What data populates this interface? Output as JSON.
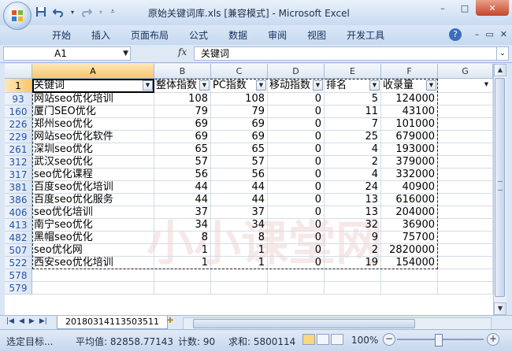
{
  "window": {
    "title": "原始关键词库.xls  [兼容模式] - Microsoft Excel",
    "controls": [
      "–",
      "□",
      "✕"
    ]
  },
  "ribbon": {
    "tabs": [
      "开始",
      "插入",
      "页面布局",
      "公式",
      "数据",
      "审阅",
      "视图",
      "开发工具"
    ],
    "help": "?"
  },
  "formula_bar": {
    "cell_ref": "A1",
    "fx": "fx",
    "content": "关键词"
  },
  "columns": [
    "A",
    "B",
    "C",
    "D",
    "E",
    "F",
    "G"
  ],
  "header_row": {
    "row_num": "1",
    "cells": [
      "关键词",
      "整体指数",
      "PC指数",
      "移动指数",
      "排名",
      "收录量"
    ]
  },
  "rows": [
    {
      "n": "93",
      "kw": "网站seo优化培训",
      "b": "108",
      "c": "108",
      "d": "0",
      "e": "5",
      "f": "124000"
    },
    {
      "n": "160",
      "kw": "厦门SEO优化",
      "b": "79",
      "c": "79",
      "d": "0",
      "e": "11",
      "f": "43100"
    },
    {
      "n": "226",
      "kw": "郑州seo优化",
      "b": "69",
      "c": "69",
      "d": "0",
      "e": "7",
      "f": "101000"
    },
    {
      "n": "229",
      "kw": "网站seo优化软件",
      "b": "69",
      "c": "69",
      "d": "0",
      "e": "25",
      "f": "679000"
    },
    {
      "n": "261",
      "kw": "深圳seo优化",
      "b": "65",
      "c": "65",
      "d": "0",
      "e": "4",
      "f": "193000"
    },
    {
      "n": "312",
      "kw": "武汉seo优化",
      "b": "57",
      "c": "57",
      "d": "0",
      "e": "2",
      "f": "379000"
    },
    {
      "n": "317",
      "kw": "seo优化课程",
      "b": "56",
      "c": "56",
      "d": "0",
      "e": "4",
      "f": "332000"
    },
    {
      "n": "381",
      "kw": "百度seo优化培训",
      "b": "44",
      "c": "44",
      "d": "0",
      "e": "24",
      "f": "40900"
    },
    {
      "n": "386",
      "kw": "百度seo优化服务",
      "b": "44",
      "c": "44",
      "d": "0",
      "e": "13",
      "f": "616000"
    },
    {
      "n": "406",
      "kw": "seo优化培训",
      "b": "37",
      "c": "37",
      "d": "0",
      "e": "13",
      "f": "204000"
    },
    {
      "n": "413",
      "kw": "南宁seo优化",
      "b": "34",
      "c": "34",
      "d": "0",
      "e": "32",
      "f": "36900"
    },
    {
      "n": "482",
      "kw": "黑帽seo优化",
      "b": "8",
      "c": "8",
      "d": "0",
      "e": "9",
      "f": "75700"
    },
    {
      "n": "507",
      "kw": "seo优化网",
      "b": "1",
      "c": "1",
      "d": "0",
      "e": "2",
      "f": "2820000"
    },
    {
      "n": "522",
      "kw": "西安seo优化培训",
      "b": "1",
      "c": "1",
      "d": "0",
      "e": "19",
      "f": "154000"
    },
    {
      "n": "578",
      "kw": "",
      "b": "",
      "c": "",
      "d": "",
      "e": "",
      "f": ""
    },
    {
      "n": "579",
      "kw": "",
      "b": "",
      "c": "",
      "d": "",
      "e": "",
      "f": ""
    }
  ],
  "sheet": {
    "tab_name": "20180314113503511"
  },
  "status": {
    "mode": "选定目标...",
    "average": "平均值: 82858.77143",
    "count": "计数: 90",
    "sum": "求和: 5800114",
    "zoom": "100%"
  }
}
